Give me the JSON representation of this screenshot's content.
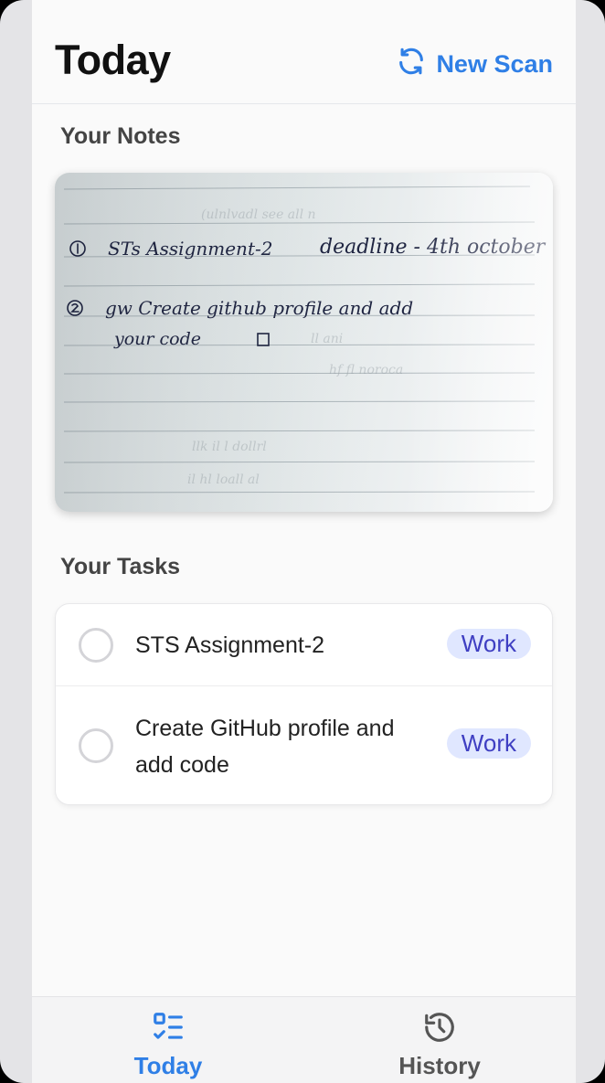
{
  "header": {
    "title": "Today",
    "new_scan_label": "New Scan",
    "new_scan_icon": "refresh-icon"
  },
  "notes_section": {
    "title": "Your Notes",
    "image_alt": "Handwritten notes photo"
  },
  "tasks_section": {
    "title": "Your Tasks",
    "tasks": [
      {
        "text": "STS Assignment-2",
        "tag": "Work",
        "done": false
      },
      {
        "text": "Create GitHub profile and add code",
        "tag": "Work",
        "done": false
      }
    ]
  },
  "bottom_nav": {
    "items": [
      {
        "label": "Today",
        "icon": "list-check-icon",
        "active": true
      },
      {
        "label": "History",
        "icon": "history-icon",
        "active": false
      }
    ]
  },
  "colors": {
    "accent": "#2f7fe6",
    "tag_bg": "#e0e7ff",
    "tag_text": "#3f3fc2",
    "inactive_nav": "#555555"
  }
}
